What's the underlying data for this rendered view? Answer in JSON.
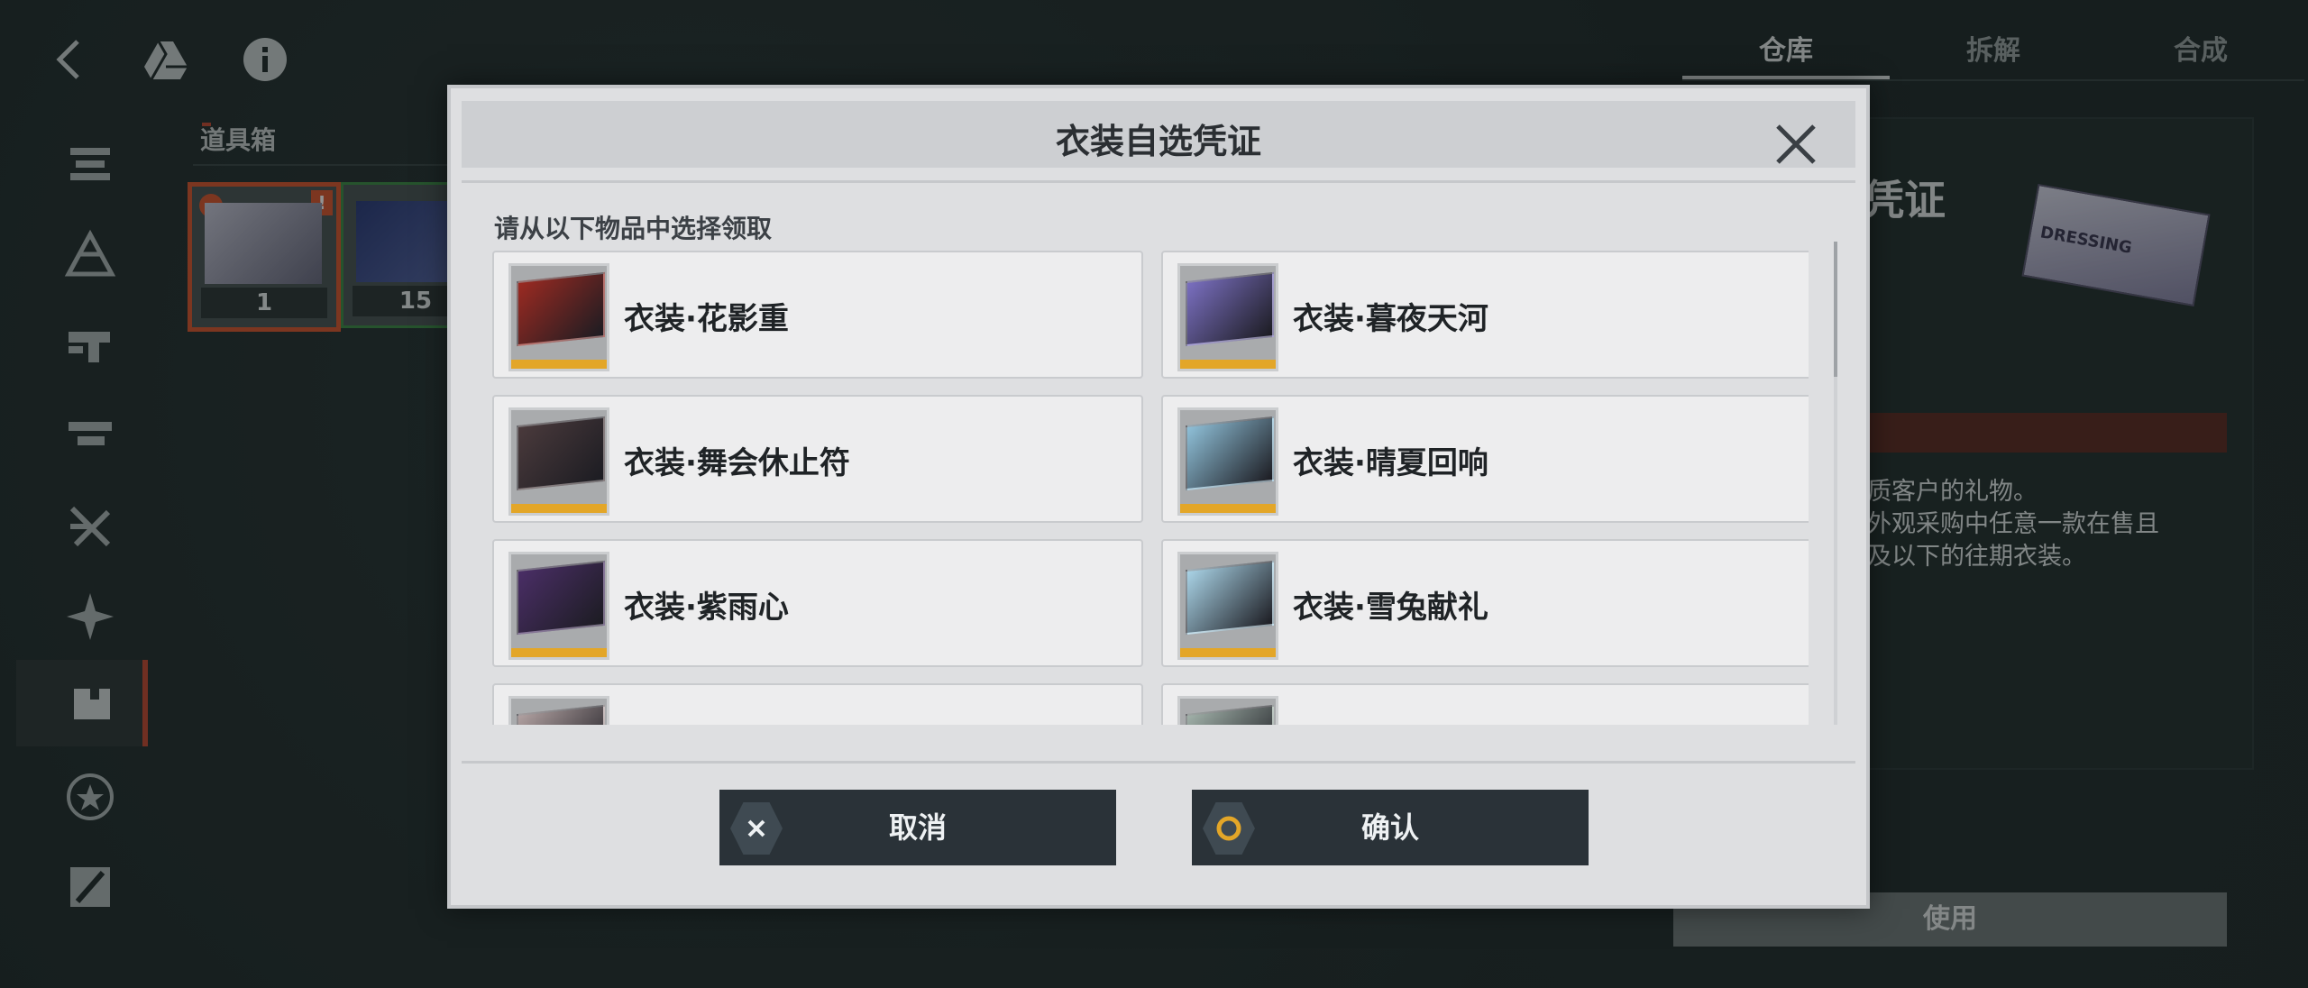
{
  "tabs": [
    {
      "label": "仓库",
      "active": true
    },
    {
      "label": "拆解",
      "active": false
    },
    {
      "label": "合成",
      "active": false
    }
  ],
  "icons": {
    "back": "back-icon",
    "drive": "drive-icon",
    "info": "info-icon"
  },
  "section": {
    "label": "道具箱"
  },
  "inventory": [
    {
      "count": "1",
      "selected": true
    },
    {
      "count": "15",
      "selected": false
    }
  ],
  "detail": {
    "title_fragment": "凭证",
    "image_word": "DRESSING",
    "description": "优质客户的礼物。\n换外观采购中任意一款在售且\n币及以下的往期衣装。",
    "use_label": "使用"
  },
  "modal": {
    "title": "衣装自选凭证",
    "prompt": "请从以下物品中选择领取",
    "items": [
      {
        "name": "衣装·花影重",
        "color": "#9b2a22"
      },
      {
        "name": "衣装·暮夜天河",
        "color": "#7a6fc0"
      },
      {
        "name": "衣装·舞会休止符",
        "color": "#4a3a3c"
      },
      {
        "name": "衣装·晴夏回响",
        "color": "#8fc0d8"
      },
      {
        "name": "衣装·紫雨心",
        "color": "#4a2e66"
      },
      {
        "name": "衣装·雪兔献礼",
        "color": "#a9d3e6"
      },
      {
        "name": "",
        "color": "#b0a0a0"
      },
      {
        "name": "",
        "color": "#a0b0a8"
      }
    ],
    "cancel_label": "取消",
    "confirm_label": "确认"
  },
  "colors": {
    "accent": "#d9572f",
    "stripe": "#e3a628",
    "button_bg": "#2a3238"
  }
}
